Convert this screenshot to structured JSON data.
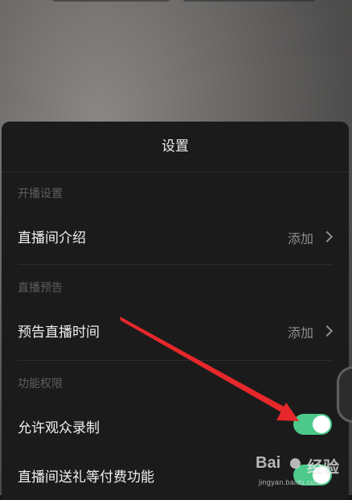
{
  "sheet": {
    "title": "设置",
    "sections": [
      {
        "label": "开播设置",
        "rows": [
          {
            "label": "直播间介绍",
            "value": "添加",
            "control": "chevron"
          }
        ]
      },
      {
        "label": "直播预告",
        "rows": [
          {
            "label": "预告直播时间",
            "value": "添加",
            "control": "chevron"
          }
        ]
      },
      {
        "label": "功能权限",
        "rows": [
          {
            "label": "允许观众录制",
            "control": "toggle",
            "on": true
          },
          {
            "label": "直播间送礼等付费功能",
            "control": "toggle",
            "on": true
          }
        ]
      }
    ]
  },
  "watermark": {
    "brand": "Bai",
    "suffix": "经验",
    "url": "jingyan.baidu.com"
  },
  "colors": {
    "toggle_on": "#4cc98b",
    "arrow": "#e6282b",
    "sheet_bg": "#1b1b1b"
  }
}
